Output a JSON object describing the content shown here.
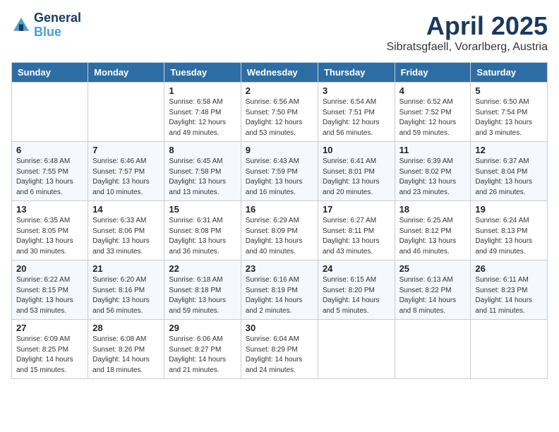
{
  "header": {
    "logo_line1": "General",
    "logo_line2": "Blue",
    "month": "April 2025",
    "location": "Sibratsgfaell, Vorarlberg, Austria"
  },
  "weekdays": [
    "Sunday",
    "Monday",
    "Tuesday",
    "Wednesday",
    "Thursday",
    "Friday",
    "Saturday"
  ],
  "weeks": [
    [
      {
        "day": "",
        "info": ""
      },
      {
        "day": "",
        "info": ""
      },
      {
        "day": "1",
        "info": "Sunrise: 6:58 AM\nSunset: 7:48 PM\nDaylight: 12 hours and 49 minutes."
      },
      {
        "day": "2",
        "info": "Sunrise: 6:56 AM\nSunset: 7:50 PM\nDaylight: 12 hours and 53 minutes."
      },
      {
        "day": "3",
        "info": "Sunrise: 6:54 AM\nSunset: 7:51 PM\nDaylight: 12 hours and 56 minutes."
      },
      {
        "day": "4",
        "info": "Sunrise: 6:52 AM\nSunset: 7:52 PM\nDaylight: 12 hours and 59 minutes."
      },
      {
        "day": "5",
        "info": "Sunrise: 6:50 AM\nSunset: 7:54 PM\nDaylight: 13 hours and 3 minutes."
      }
    ],
    [
      {
        "day": "6",
        "info": "Sunrise: 6:48 AM\nSunset: 7:55 PM\nDaylight: 13 hours and 6 minutes."
      },
      {
        "day": "7",
        "info": "Sunrise: 6:46 AM\nSunset: 7:57 PM\nDaylight: 13 hours and 10 minutes."
      },
      {
        "day": "8",
        "info": "Sunrise: 6:45 AM\nSunset: 7:58 PM\nDaylight: 13 hours and 13 minutes."
      },
      {
        "day": "9",
        "info": "Sunrise: 6:43 AM\nSunset: 7:59 PM\nDaylight: 13 hours and 16 minutes."
      },
      {
        "day": "10",
        "info": "Sunrise: 6:41 AM\nSunset: 8:01 PM\nDaylight: 13 hours and 20 minutes."
      },
      {
        "day": "11",
        "info": "Sunrise: 6:39 AM\nSunset: 8:02 PM\nDaylight: 13 hours and 23 minutes."
      },
      {
        "day": "12",
        "info": "Sunrise: 6:37 AM\nSunset: 8:04 PM\nDaylight: 13 hours and 26 minutes."
      }
    ],
    [
      {
        "day": "13",
        "info": "Sunrise: 6:35 AM\nSunset: 8:05 PM\nDaylight: 13 hours and 30 minutes."
      },
      {
        "day": "14",
        "info": "Sunrise: 6:33 AM\nSunset: 8:06 PM\nDaylight: 13 hours and 33 minutes."
      },
      {
        "day": "15",
        "info": "Sunrise: 6:31 AM\nSunset: 8:08 PM\nDaylight: 13 hours and 36 minutes."
      },
      {
        "day": "16",
        "info": "Sunrise: 6:29 AM\nSunset: 8:09 PM\nDaylight: 13 hours and 40 minutes."
      },
      {
        "day": "17",
        "info": "Sunrise: 6:27 AM\nSunset: 8:11 PM\nDaylight: 13 hours and 43 minutes."
      },
      {
        "day": "18",
        "info": "Sunrise: 6:25 AM\nSunset: 8:12 PM\nDaylight: 13 hours and 46 minutes."
      },
      {
        "day": "19",
        "info": "Sunrise: 6:24 AM\nSunset: 8:13 PM\nDaylight: 13 hours and 49 minutes."
      }
    ],
    [
      {
        "day": "20",
        "info": "Sunrise: 6:22 AM\nSunset: 8:15 PM\nDaylight: 13 hours and 53 minutes."
      },
      {
        "day": "21",
        "info": "Sunrise: 6:20 AM\nSunset: 8:16 PM\nDaylight: 13 hours and 56 minutes."
      },
      {
        "day": "22",
        "info": "Sunrise: 6:18 AM\nSunset: 8:18 PM\nDaylight: 13 hours and 59 minutes."
      },
      {
        "day": "23",
        "info": "Sunrise: 6:16 AM\nSunset: 8:19 PM\nDaylight: 14 hours and 2 minutes."
      },
      {
        "day": "24",
        "info": "Sunrise: 6:15 AM\nSunset: 8:20 PM\nDaylight: 14 hours and 5 minutes."
      },
      {
        "day": "25",
        "info": "Sunrise: 6:13 AM\nSunset: 8:22 PM\nDaylight: 14 hours and 8 minutes."
      },
      {
        "day": "26",
        "info": "Sunrise: 6:11 AM\nSunset: 8:23 PM\nDaylight: 14 hours and 11 minutes."
      }
    ],
    [
      {
        "day": "27",
        "info": "Sunrise: 6:09 AM\nSunset: 8:25 PM\nDaylight: 14 hours and 15 minutes."
      },
      {
        "day": "28",
        "info": "Sunrise: 6:08 AM\nSunset: 8:26 PM\nDaylight: 14 hours and 18 minutes."
      },
      {
        "day": "29",
        "info": "Sunrise: 6:06 AM\nSunset: 8:27 PM\nDaylight: 14 hours and 21 minutes."
      },
      {
        "day": "30",
        "info": "Sunrise: 6:04 AM\nSunset: 8:29 PM\nDaylight: 14 hours and 24 minutes."
      },
      {
        "day": "",
        "info": ""
      },
      {
        "day": "",
        "info": ""
      },
      {
        "day": "",
        "info": ""
      }
    ]
  ]
}
